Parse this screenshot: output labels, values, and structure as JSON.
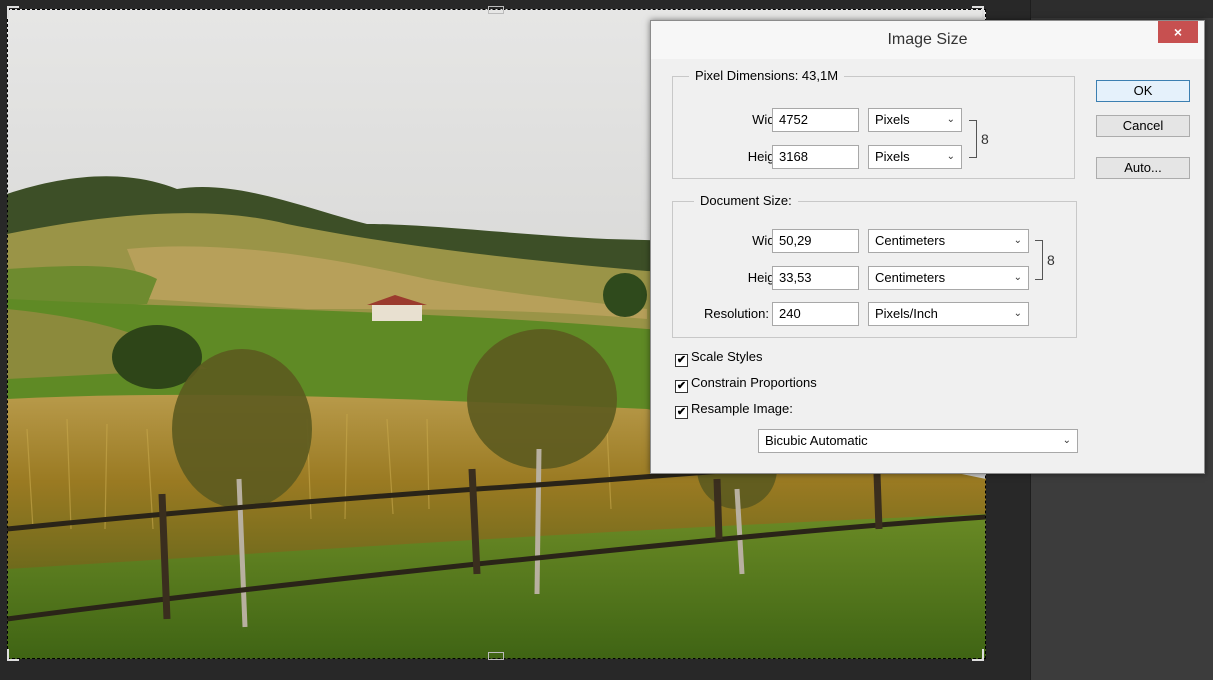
{
  "dialog": {
    "title": "Image Size",
    "close_glyph": "×",
    "buttons": {
      "ok": "OK",
      "cancel": "Cancel",
      "auto": "Auto..."
    },
    "pixel_dimensions": {
      "title": "Pixel Dimensions:  43,1M",
      "width_label": "Width:",
      "width_value": "4752",
      "width_unit": "Pixels",
      "height_label": "Height:",
      "height_value": "3168",
      "height_unit": "Pixels"
    },
    "document_size": {
      "title": "Document Size:",
      "width_label": "Width:",
      "width_value": "50,29",
      "width_unit": "Centimeters",
      "height_label": "Height:",
      "height_value": "33,53",
      "height_unit": "Centimeters",
      "resolution_label": "Resolution:",
      "resolution_value": "240",
      "resolution_unit": "Pixels/Inch"
    },
    "options": {
      "scale_styles": {
        "label": "Scale Styles",
        "checked": true
      },
      "constrain_proportions": {
        "label": "Constrain Proportions",
        "checked": true
      },
      "resample_image": {
        "label": "Resample Image:",
        "checked": true
      },
      "resample_method": "Bicubic Automatic"
    },
    "check_glyph": "✔",
    "dropdown_glyph": "⌄",
    "link_glyph": "8"
  },
  "canvas": {
    "icons": [
      "landscape-photo"
    ],
    "colors": {
      "sky": "#d9d9d7",
      "hill": "#8b8d45",
      "field": "#a98a2f",
      "grass": "#4f7a1c"
    }
  }
}
